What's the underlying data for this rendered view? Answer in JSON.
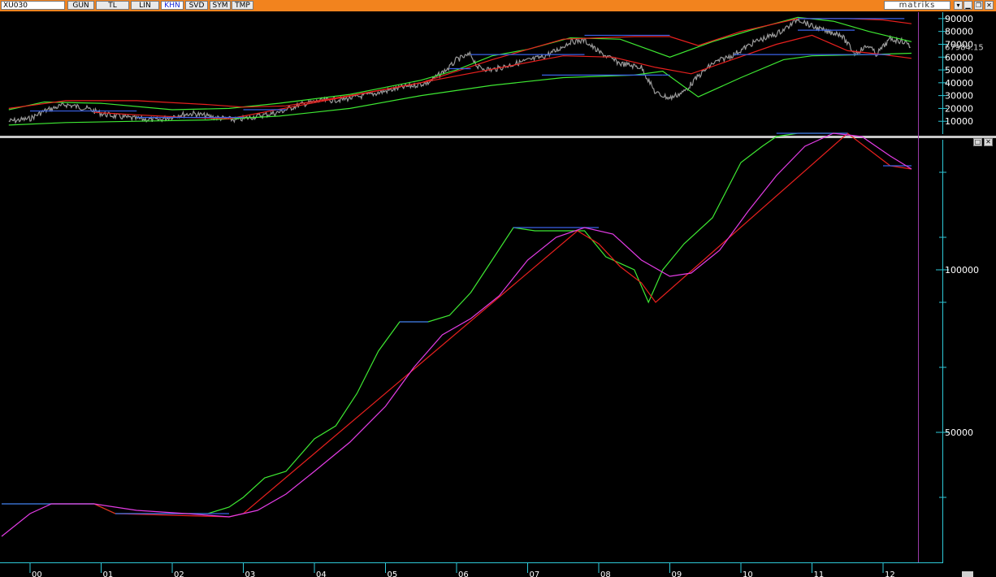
{
  "toolbar": {
    "symbol": "XU030",
    "buttons": [
      {
        "label": "GUN",
        "active": false
      },
      {
        "label": "TL",
        "active": false
      },
      {
        "label": "LIN",
        "active": false
      },
      {
        "label": "KHN",
        "active": true
      },
      {
        "label": "SVD",
        "active": false
      },
      {
        "label": "SYM",
        "active": false
      },
      {
        "label": "TMP",
        "active": false
      }
    ],
    "brand": "matriks",
    "window_buttons": [
      "▾",
      "▁",
      "❐",
      "✕"
    ]
  },
  "panel_buttons": [
    "□",
    "✕"
  ],
  "colors": {
    "toolbar": "#f2831e",
    "price": "#9a9a9a",
    "green": "#3ee832",
    "red": "#e8201e",
    "blue": "#3a62e8",
    "magenta": "#e43ce6",
    "axis": "#2ec8d8",
    "cursor": "#9a3aa8"
  },
  "chart_data": [
    {
      "type": "line",
      "name": "top",
      "y_ticks": [
        10000,
        20000,
        30000,
        40000,
        50000,
        60000,
        70000,
        80000,
        90000
      ],
      "last_value": "67984.15",
      "ylim": [
        0,
        95000
      ],
      "grid": false,
      "series": [
        {
          "role": "price",
          "points": [
            [
              -0.3,
              10000
            ],
            [
              0,
              12000
            ],
            [
              0.2,
              18000
            ],
            [
              0.5,
              23000
            ],
            [
              0.8,
              20000
            ],
            [
              1.0,
              16000
            ],
            [
              1.2,
              14000
            ],
            [
              1.5,
              12000
            ],
            [
              1.8,
              11000
            ],
            [
              2.1,
              15000
            ],
            [
              2.3,
              16000
            ],
            [
              2.6,
              13000
            ],
            [
              2.9,
              11000
            ],
            [
              3.2,
              14000
            ],
            [
              3.5,
              17000
            ],
            [
              3.8,
              23000
            ],
            [
              4.1,
              26000
            ],
            [
              4.4,
              27000
            ],
            [
              4.8,
              31000
            ],
            [
              5.2,
              36000
            ],
            [
              5.6,
              40000
            ],
            [
              5.9,
              52000
            ],
            [
              6.0,
              58000
            ],
            [
              6.2,
              62000
            ],
            [
              6.3,
              52000
            ],
            [
              6.5,
              50000
            ],
            [
              6.9,
              56000
            ],
            [
              7.2,
              60000
            ],
            [
              7.4,
              65000
            ],
            [
              7.6,
              72000
            ],
            [
              7.8,
              73000
            ],
            [
              8.0,
              64000
            ],
            [
              8.3,
              55000
            ],
            [
              8.6,
              52000
            ],
            [
              8.8,
              32000
            ],
            [
              9.0,
              28000
            ],
            [
              9.2,
              33000
            ],
            [
              9.4,
              45000
            ],
            [
              9.6,
              55000
            ],
            [
              9.9,
              62000
            ],
            [
              10.2,
              72000
            ],
            [
              10.5,
              78000
            ],
            [
              10.7,
              85000
            ],
            [
              10.8,
              90000
            ],
            [
              11.0,
              84000
            ],
            [
              11.2,
              80000
            ],
            [
              11.4,
              78000
            ],
            [
              11.6,
              63000
            ],
            [
              11.8,
              69000
            ],
            [
              11.9,
              62000
            ],
            [
              12.1,
              74000
            ],
            [
              12.3,
              72000
            ],
            [
              12.4,
              68000
            ]
          ]
        },
        {
          "role": "green-upper",
          "points": [
            [
              -0.3,
              19000
            ],
            [
              0.2,
              25000
            ],
            [
              1.0,
              24000
            ],
            [
              2.0,
              19000
            ],
            [
              2.8,
              20000
            ],
            [
              3.5,
              24000
            ],
            [
              4.5,
              31000
            ],
            [
              5.5,
              42000
            ],
            [
              6.0,
              50000
            ],
            [
              6.5,
              61000
            ],
            [
              7.0,
              66000
            ],
            [
              7.6,
              75000
            ],
            [
              8.3,
              74000
            ],
            [
              9.0,
              60000
            ],
            [
              9.6,
              72000
            ],
            [
              10.2,
              82000
            ],
            [
              10.8,
              91000
            ],
            [
              11.3,
              88000
            ],
            [
              11.8,
              80000
            ],
            [
              12.4,
              72000
            ]
          ]
        },
        {
          "role": "green-lower",
          "points": [
            [
              -0.3,
              7000
            ],
            [
              0.5,
              9000
            ],
            [
              1.5,
              10000
            ],
            [
              2.5,
              11000
            ],
            [
              3.5,
              14000
            ],
            [
              4.5,
              20000
            ],
            [
              5.5,
              30000
            ],
            [
              6.5,
              38000
            ],
            [
              7.5,
              44000
            ],
            [
              8.5,
              46000
            ],
            [
              8.9,
              49000
            ],
            [
              9.4,
              29000
            ],
            [
              10.0,
              44000
            ],
            [
              10.6,
              58000
            ],
            [
              11.0,
              61000
            ],
            [
              11.8,
              62000
            ],
            [
              12.4,
              63000
            ]
          ]
        },
        {
          "role": "red-upper",
          "points": [
            [
              -0.3,
              20000
            ],
            [
              0.5,
              26000
            ],
            [
              1.5,
              26000
            ],
            [
              2.5,
              23000
            ],
            [
              3.0,
              21000
            ],
            [
              3.6,
              22000
            ],
            [
              4.5,
              30000
            ],
            [
              5.5,
              40000
            ],
            [
              6.5,
              58000
            ],
            [
              7.5,
              74000
            ],
            [
              8.5,
              76000
            ],
            [
              9.0,
              76000
            ],
            [
              9.4,
              69000
            ],
            [
              10.0,
              80000
            ],
            [
              10.8,
              90000
            ],
            [
              11.5,
              90000
            ],
            [
              12.0,
              89000
            ],
            [
              12.4,
              86000
            ]
          ]
        },
        {
          "role": "red-lower",
          "points": [
            [
              0.9,
              17000
            ],
            [
              1.5,
              15000
            ],
            [
              2.2,
              13000
            ],
            [
              2.8,
              12000
            ],
            [
              7.5,
              61000
            ],
            [
              8.2,
              60000
            ],
            [
              8.8,
              52000
            ],
            [
              9.3,
              47000
            ],
            [
              10.5,
              70000
            ],
            [
              11.0,
              77000
            ],
            [
              11.5,
              65000
            ],
            [
              12.0,
              62000
            ],
            [
              12.4,
              59000
            ]
          ]
        },
        {
          "role": "blue-levels",
          "segments": [
            [
              [
                0,
                18000
              ],
              [
                1.5,
                18000
              ]
            ],
            [
              [
                1.5,
                13000
              ],
              [
                3.0,
                13000
              ]
            ],
            [
              [
                3.0,
                19000
              ],
              [
                3.6,
                19000
              ]
            ],
            [
              [
                5.9,
                51000
              ],
              [
                6.2,
                51000
              ]
            ],
            [
              [
                6.2,
                62000
              ],
              [
                7.8,
                62000
              ]
            ],
            [
              [
                7.8,
                77000
              ],
              [
                9.0,
                77000
              ]
            ],
            [
              [
                9.0,
                46000
              ],
              [
                8.9,
                46000
              ]
            ],
            [
              [
                7.2,
                46000
              ],
              [
                8.9,
                46000
              ]
            ],
            [
              [
                9.9,
                62000
              ],
              [
                12.1,
                62000
              ]
            ],
            [
              [
                10.8,
                90000
              ],
              [
                12.3,
                90000
              ]
            ],
            [
              [
                10.8,
                81000
              ],
              [
                11.6,
                81000
              ]
            ]
          ]
        }
      ]
    },
    {
      "type": "line",
      "name": "bottom",
      "y_ticks": [
        50000,
        100000
      ],
      "ylim": [
        10000,
        140000
      ],
      "grid": false,
      "x_ticks": [
        "00",
        "01",
        "02",
        "03",
        "04",
        "05",
        "06",
        "07",
        "08",
        "09",
        "10",
        "11",
        "12"
      ],
      "series": [
        {
          "role": "green",
          "points": [
            [
              -0.4,
              28000
            ],
            [
              0.3,
              28000
            ],
            [
              0.9,
              28000
            ],
            [
              1.2,
              25000
            ],
            [
              2.5,
              25000
            ],
            [
              2.8,
              27000
            ],
            [
              3.0,
              30000
            ],
            [
              3.3,
              36000
            ],
            [
              3.6,
              38000
            ],
            [
              4.0,
              48000
            ],
            [
              4.3,
              52000
            ],
            [
              4.6,
              62000
            ],
            [
              4.9,
              75000
            ],
            [
              5.2,
              84000
            ],
            [
              5.6,
              84000
            ],
            [
              5.9,
              86000
            ],
            [
              6.2,
              93000
            ],
            [
              6.5,
              103000
            ],
            [
              6.8,
              113000
            ],
            [
              7.1,
              112000
            ],
            [
              7.4,
              112000
            ],
            [
              7.8,
              112000
            ],
            [
              8.1,
              104000
            ],
            [
              8.5,
              100000
            ],
            [
              8.7,
              90000
            ],
            [
              8.9,
              100000
            ],
            [
              9.2,
              108000
            ],
            [
              9.6,
              116000
            ],
            [
              10.0,
              133000
            ],
            [
              10.3,
              138000
            ],
            [
              10.5,
              141000
            ],
            [
              10.8,
              142000
            ],
            [
              11.5,
              142000
            ]
          ]
        },
        {
          "role": "red",
          "points": [
            [
              0.9,
              28000
            ],
            [
              1.2,
              25000
            ],
            [
              2.8,
              24000
            ],
            [
              3.0,
              25000
            ],
            [
              7.7,
              112000
            ],
            [
              8.0,
              108000
            ],
            [
              8.3,
              101000
            ],
            [
              8.6,
              96000
            ],
            [
              8.8,
              90000
            ],
            [
              11.5,
              142000
            ],
            [
              11.8,
              137000
            ],
            [
              12.1,
              132000
            ],
            [
              12.4,
              131000
            ]
          ]
        },
        {
          "role": "blue",
          "segments": [
            [
              [
                -0.4,
                28000
              ],
              [
                0.9,
                28000
              ]
            ],
            [
              [
                1.2,
                25000
              ],
              [
                2.8,
                25000
              ]
            ],
            [
              [
                5.2,
                84000
              ],
              [
                5.6,
                84000
              ]
            ],
            [
              [
                6.8,
                113000
              ],
              [
                8.0,
                113000
              ]
            ],
            [
              [
                10.5,
                142000
              ],
              [
                11.5,
                142000
              ]
            ],
            [
              [
                12.0,
                132000
              ],
              [
                12.4,
                132000
              ]
            ]
          ]
        },
        {
          "role": "magenta",
          "points": [
            [
              -0.4,
              18000
            ],
            [
              0.0,
              25000
            ],
            [
              0.3,
              28000
            ],
            [
              0.9,
              28000
            ],
            [
              1.5,
              26000
            ],
            [
              2.2,
              25000
            ],
            [
              2.8,
              24000
            ],
            [
              3.2,
              26000
            ],
            [
              3.6,
              31000
            ],
            [
              4.0,
              38000
            ],
            [
              4.5,
              47000
            ],
            [
              5.0,
              58000
            ],
            [
              5.4,
              70000
            ],
            [
              5.8,
              80000
            ],
            [
              6.2,
              85000
            ],
            [
              6.6,
              92000
            ],
            [
              7.0,
              103000
            ],
            [
              7.4,
              110000
            ],
            [
              7.8,
              113000
            ],
            [
              8.2,
              111000
            ],
            [
              8.6,
              103000
            ],
            [
              9.0,
              98000
            ],
            [
              9.3,
              99000
            ],
            [
              9.7,
              106000
            ],
            [
              10.1,
              118000
            ],
            [
              10.5,
              129000
            ],
            [
              10.9,
              138000
            ],
            [
              11.3,
              142000
            ],
            [
              11.7,
              141000
            ],
            [
              12.1,
              135000
            ],
            [
              12.4,
              131000
            ]
          ]
        }
      ]
    }
  ]
}
